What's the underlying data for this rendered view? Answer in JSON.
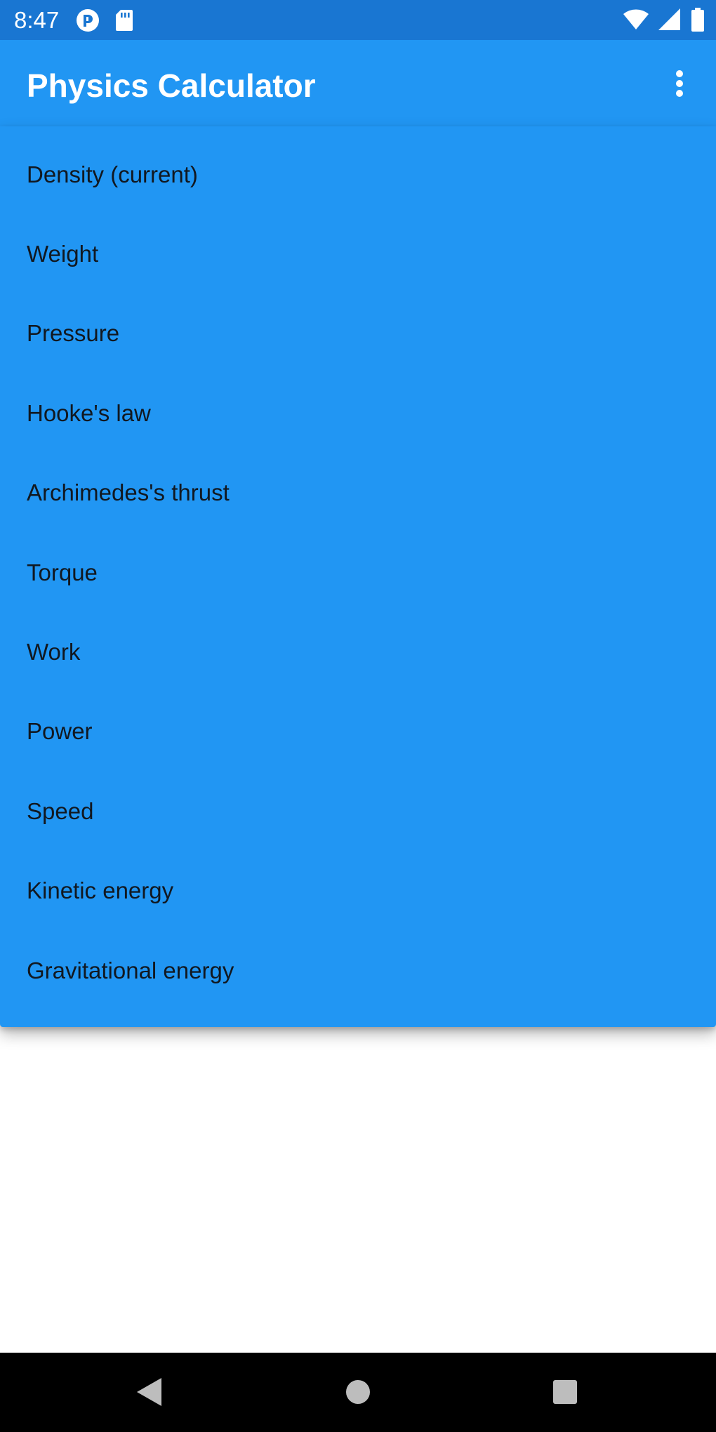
{
  "status_bar": {
    "time": "8:47",
    "left_icons": [
      "notification-app-icon",
      "sd-card-icon"
    ],
    "right_icons": [
      "wifi-icon",
      "cellular-signal-icon",
      "battery-icon"
    ]
  },
  "app_bar": {
    "title": "Physics Calculator",
    "overflow_icon": "more-vert-icon"
  },
  "menu": {
    "items": [
      {
        "label": "Density (current)"
      },
      {
        "label": "Weight"
      },
      {
        "label": "Pressure"
      },
      {
        "label": "Hooke's law"
      },
      {
        "label": "Archimedes's thrust"
      },
      {
        "label": "Torque"
      },
      {
        "label": "Work"
      },
      {
        "label": "Power"
      },
      {
        "label": "Speed"
      },
      {
        "label": "Kinetic energy"
      },
      {
        "label": "Gravitational energy"
      }
    ]
  },
  "nav_bar": {
    "buttons": [
      "back-icon",
      "home-icon",
      "recents-icon"
    ]
  },
  "colors": {
    "status_bar": "#1976d2",
    "primary": "#2196f3",
    "menu_text": "#111820",
    "nav_bar": "#000000",
    "background": "#ffffff"
  }
}
